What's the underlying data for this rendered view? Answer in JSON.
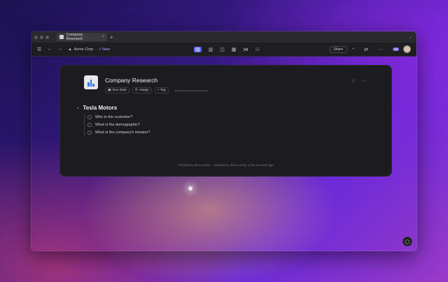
{
  "tab": {
    "title": "Company Research"
  },
  "toolbar": {
    "workspace": "Acme Corp",
    "new_label": "+ New",
    "share_label": "Share",
    "notif_count": "19"
  },
  "doc": {
    "title": "Company Research",
    "chips": {
      "due_date": "Due Date",
      "assign": "Assign",
      "tag": "+ Tag"
    }
  },
  "section": {
    "title": "Tesla Motors",
    "items": [
      {
        "label": "Who is the customer?"
      },
      {
        "label": "What is the demographic?"
      },
      {
        "label": "What is the company's mission?"
      }
    ]
  },
  "footer": {
    "note": "Created by demo-emily · Updated by demo-emily a few seconds ago"
  }
}
